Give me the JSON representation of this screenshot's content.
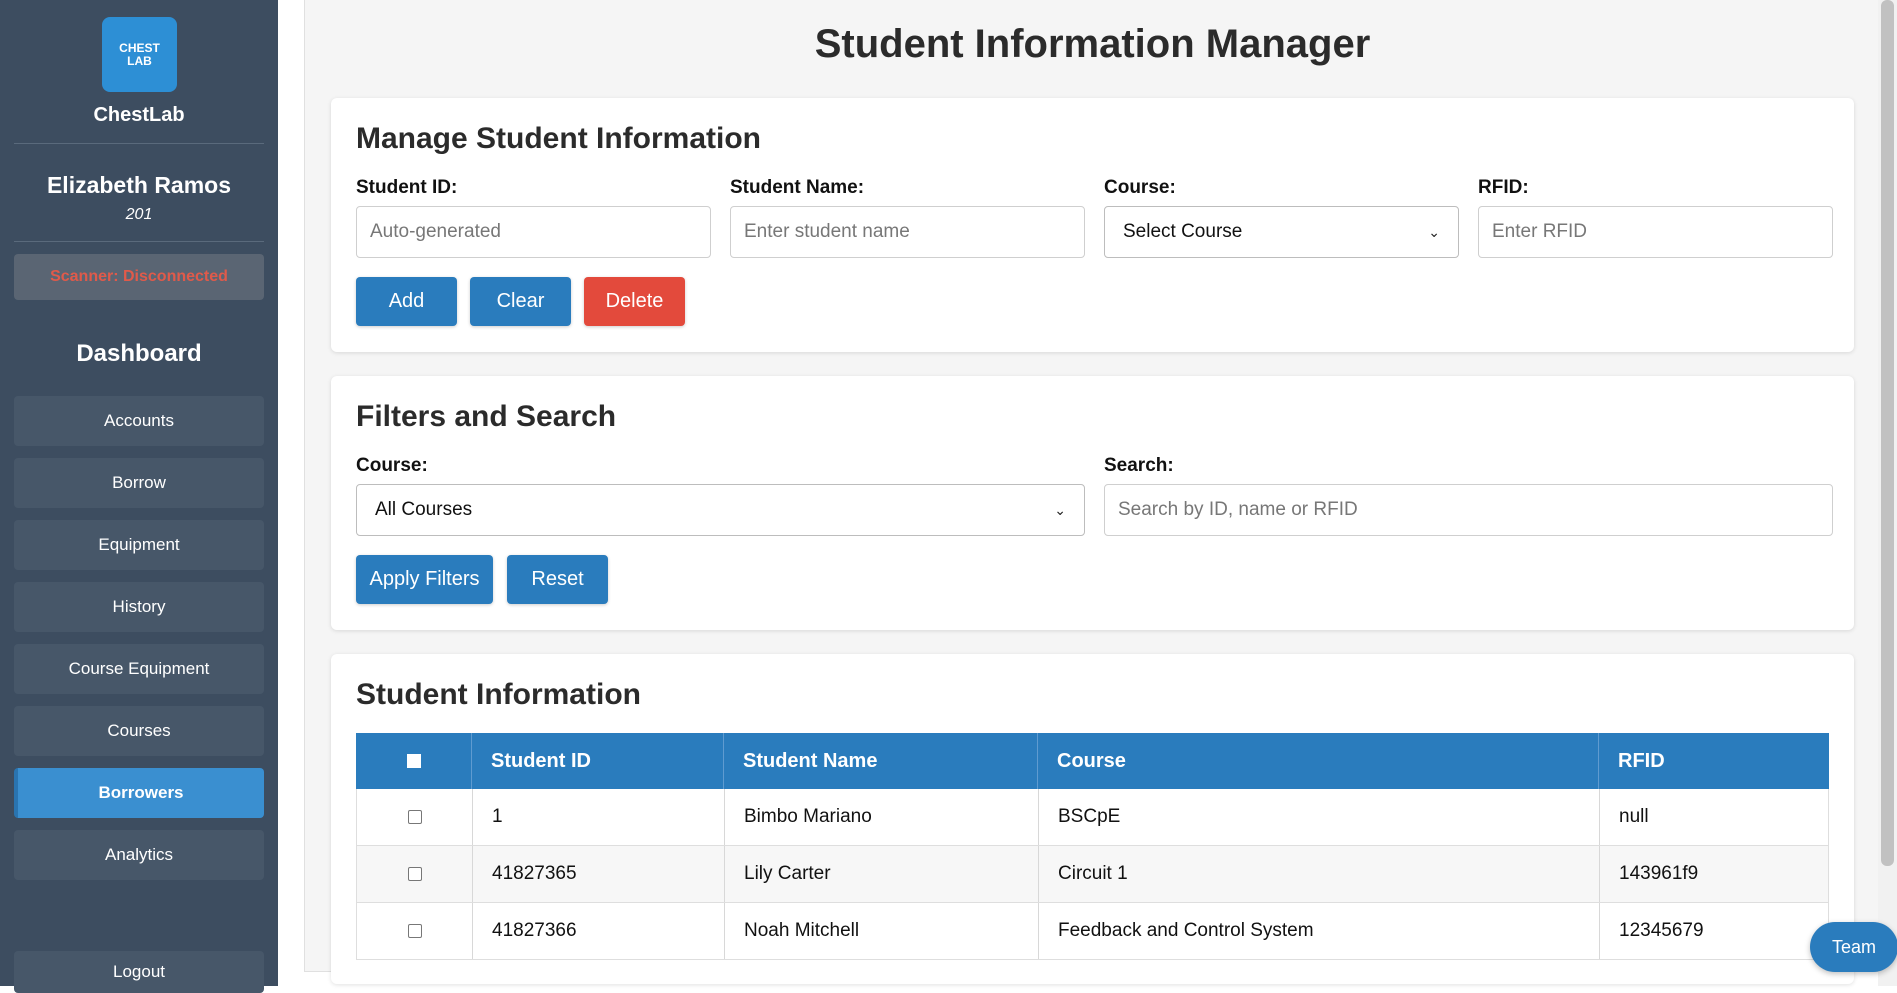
{
  "sidebar": {
    "logo_line1": "CHEST",
    "logo_line2": "LAB",
    "app_name": "ChestLab",
    "user_name": "Elizabeth Ramos",
    "user_id": "201",
    "scanner_status": "Scanner: Disconnected",
    "dashboard_title": "Dashboard",
    "items": [
      {
        "label": "Accounts"
      },
      {
        "label": "Borrow"
      },
      {
        "label": "Equipment"
      },
      {
        "label": "History"
      },
      {
        "label": "Course Equipment"
      },
      {
        "label": "Courses"
      },
      {
        "label": "Borrowers",
        "active": true
      },
      {
        "label": "Analytics"
      }
    ],
    "logout_label": "Logout"
  },
  "page_title": "Student Information Manager",
  "manage": {
    "title": "Manage Student Information",
    "student_id_label": "Student ID:",
    "student_id_placeholder": "Auto-generated",
    "student_name_label": "Student Name:",
    "student_name_placeholder": "Enter student name",
    "course_label": "Course:",
    "course_selected": "Select Course",
    "rfid_label": "RFID:",
    "rfid_placeholder": "Enter RFID",
    "add_label": "Add",
    "clear_label": "Clear",
    "delete_label": "Delete"
  },
  "filters": {
    "title": "Filters and Search",
    "course_label": "Course:",
    "course_selected": "All Courses",
    "search_label": "Search:",
    "search_placeholder": "Search by ID, name or RFID",
    "apply_label": "Apply Filters",
    "reset_label": "Reset"
  },
  "students": {
    "title": "Student Information",
    "columns": [
      "Student ID",
      "Student Name",
      "Course",
      "RFID"
    ],
    "rows": [
      {
        "id": "1",
        "name": "Bimbo Mariano",
        "course": "BSCpE",
        "rfid": "null"
      },
      {
        "id": "41827365",
        "name": "Lily Carter",
        "course": "Circuit 1",
        "rfid": "143961f9"
      },
      {
        "id": "41827366",
        "name": "Noah Mitchell",
        "course": "Feedback and Control System",
        "rfid": "12345679"
      }
    ]
  },
  "team_label": "Team",
  "colors": {
    "sidebar_bg": "#3d4d60",
    "accent": "#2a7cbd",
    "danger": "#e34a3c",
    "scanner_text": "#e05a4a"
  }
}
